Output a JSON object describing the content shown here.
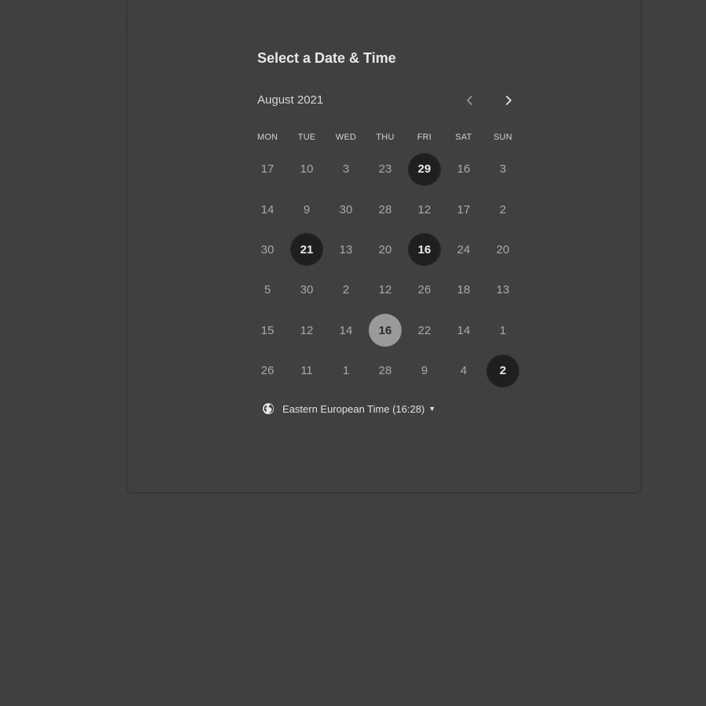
{
  "scheduler": {
    "title": "Select a Date & Time",
    "month_label": "August 2021",
    "prev_icon": "chevron-left-icon",
    "next_icon": "chevron-right-icon"
  },
  "weekdays": [
    "MON",
    "TUE",
    "WED",
    "THU",
    "FRI",
    "SAT",
    "SUN"
  ],
  "weeks": [
    [
      {
        "label": "17",
        "state": "default"
      },
      {
        "label": "10",
        "state": "default"
      },
      {
        "label": "3",
        "state": "default"
      },
      {
        "label": "23",
        "state": "default"
      },
      {
        "label": "29",
        "state": "available"
      },
      {
        "label": "16",
        "state": "default"
      },
      {
        "label": "3",
        "state": "default"
      }
    ],
    [
      {
        "label": "14",
        "state": "default"
      },
      {
        "label": "9",
        "state": "default"
      },
      {
        "label": "30",
        "state": "default"
      },
      {
        "label": "28",
        "state": "default"
      },
      {
        "label": "12",
        "state": "default"
      },
      {
        "label": "17",
        "state": "default"
      },
      {
        "label": "2",
        "state": "default"
      }
    ],
    [
      {
        "label": "30",
        "state": "default"
      },
      {
        "label": "21",
        "state": "available"
      },
      {
        "label": "13",
        "state": "default"
      },
      {
        "label": "20",
        "state": "default"
      },
      {
        "label": "16",
        "state": "available"
      },
      {
        "label": "24",
        "state": "default"
      },
      {
        "label": "20",
        "state": "default"
      }
    ],
    [
      {
        "label": "5",
        "state": "default"
      },
      {
        "label": "30",
        "state": "default"
      },
      {
        "label": "2",
        "state": "default"
      },
      {
        "label": "12",
        "state": "default"
      },
      {
        "label": "26",
        "state": "default"
      },
      {
        "label": "18",
        "state": "default"
      },
      {
        "label": "13",
        "state": "default"
      }
    ],
    [
      {
        "label": "15",
        "state": "default"
      },
      {
        "label": "12",
        "state": "default"
      },
      {
        "label": "14",
        "state": "default"
      },
      {
        "label": "16",
        "state": "selected"
      },
      {
        "label": "22",
        "state": "default"
      },
      {
        "label": "14",
        "state": "default"
      },
      {
        "label": "1",
        "state": "default"
      }
    ],
    [
      {
        "label": "26",
        "state": "default"
      },
      {
        "label": "11",
        "state": "default"
      },
      {
        "label": "1",
        "state": "default"
      },
      {
        "label": "28",
        "state": "default"
      },
      {
        "label": "9",
        "state": "default"
      },
      {
        "label": "4",
        "state": "default"
      },
      {
        "label": "2",
        "state": "available"
      }
    ]
  ],
  "timezone": {
    "label": "Eastern European Time (16:28)",
    "icon": "globe-icon",
    "caret_icon": "caret-down-icon"
  },
  "colors": {
    "background": "#404040",
    "available_day": "#1f1f1f",
    "selected_day": "#9a9a9a",
    "text_primary": "#e8e8e8",
    "text_muted": "#a9a9a9"
  }
}
